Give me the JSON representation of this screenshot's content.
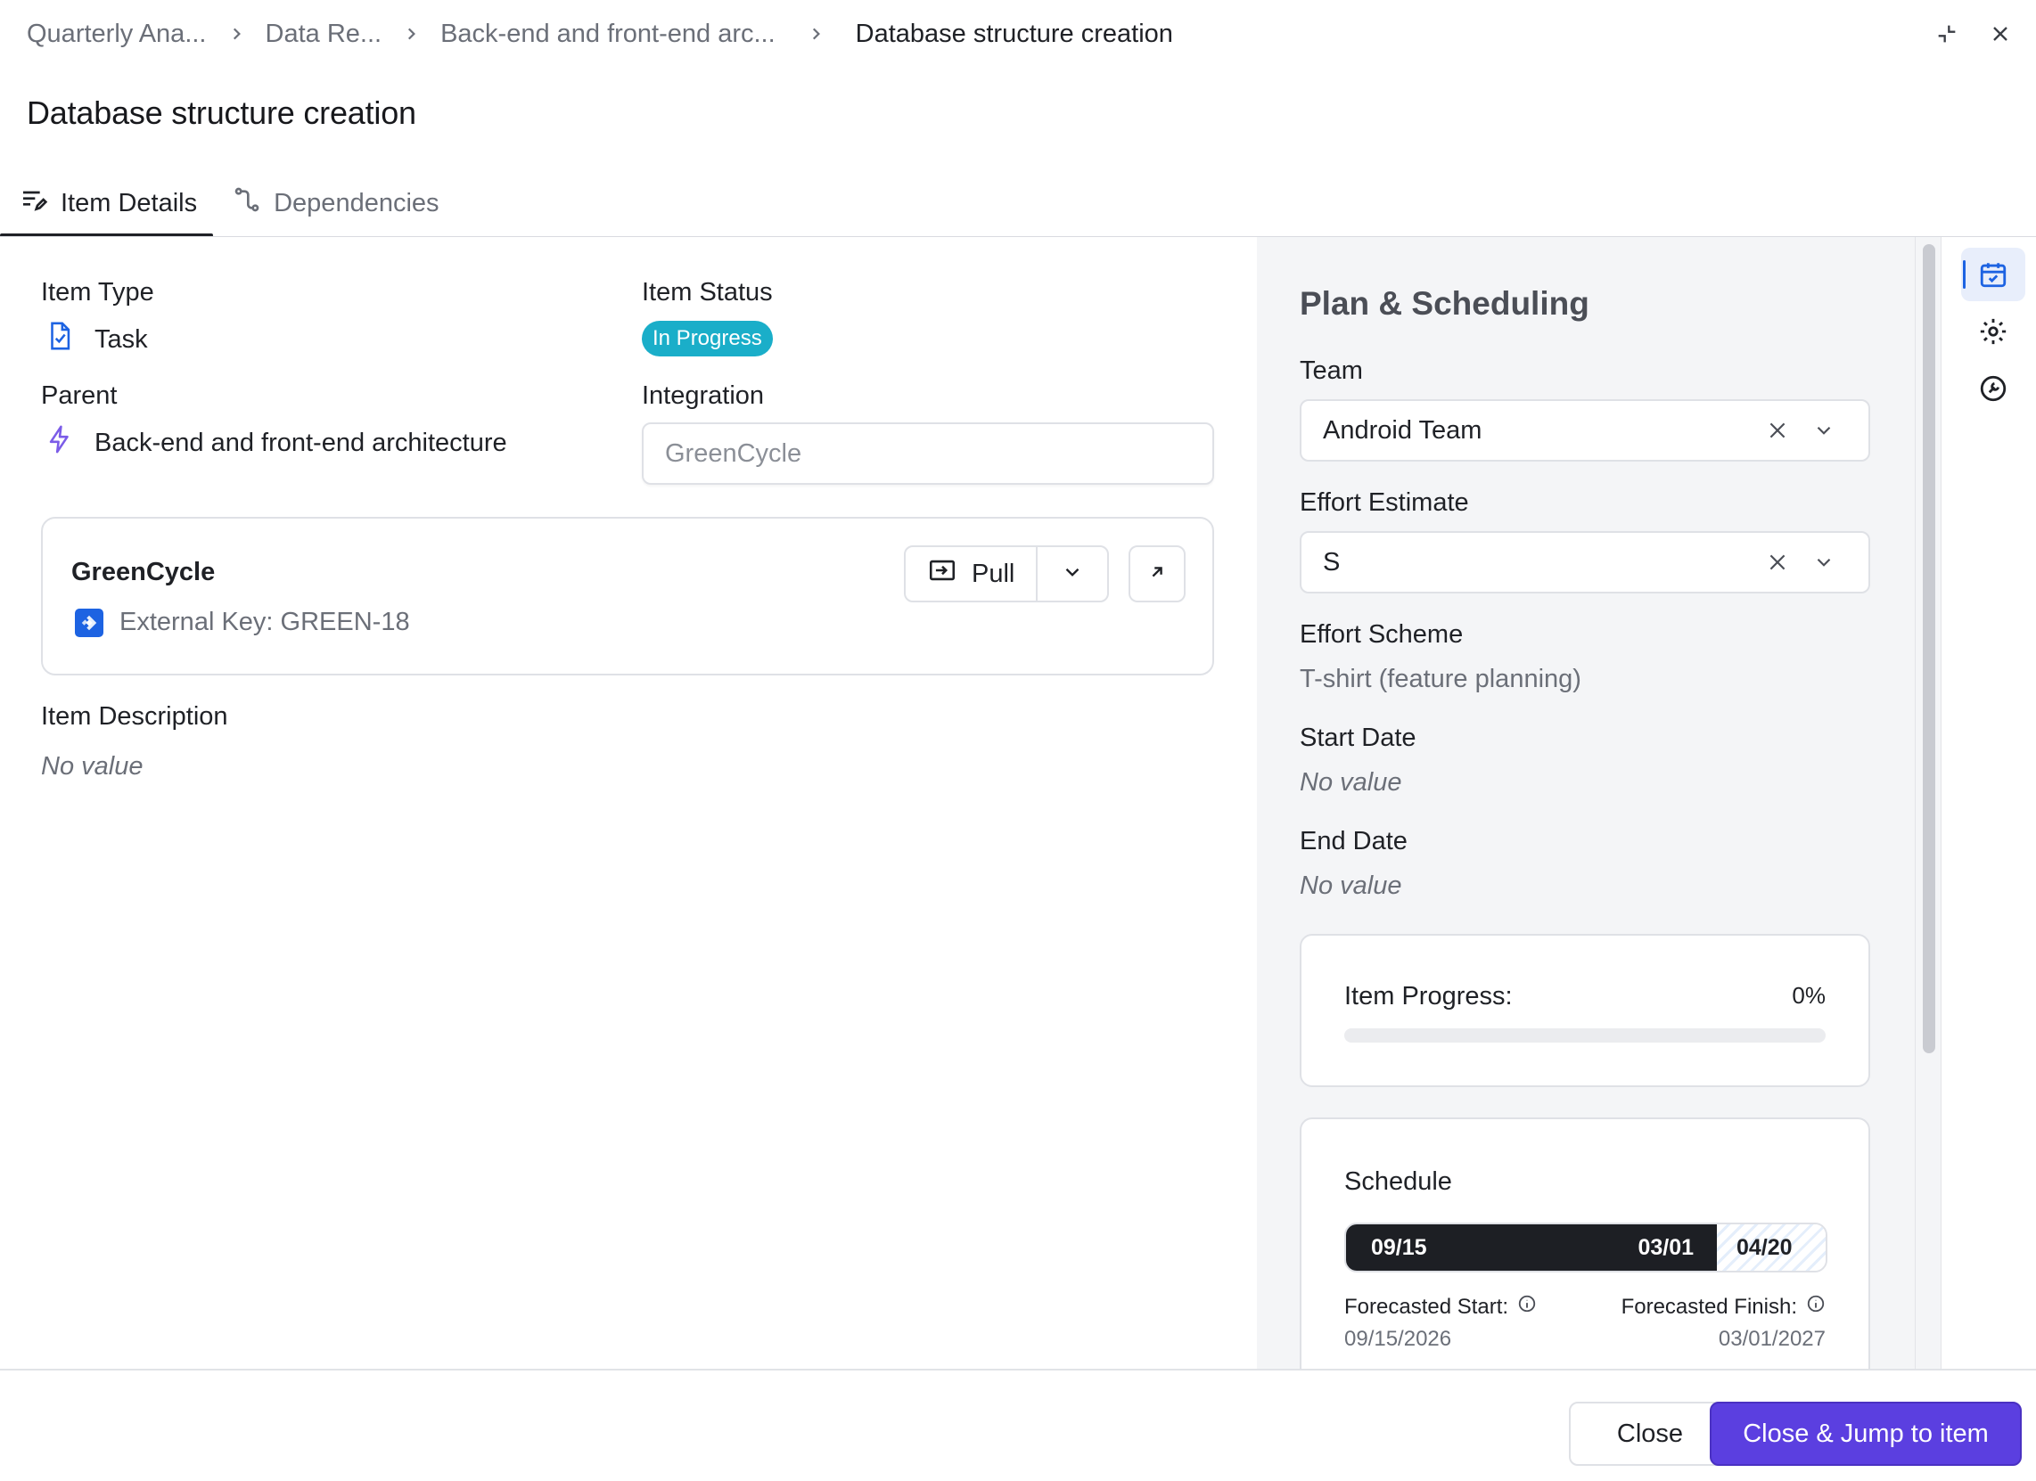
{
  "breadcrumb": {
    "items": [
      "Quarterly Ana...",
      "Data Re...",
      "Back-end and front-end arc...",
      "Database structure creation"
    ]
  },
  "window": {
    "minimize_icon": "collapse-icon",
    "close_icon": "close-icon"
  },
  "page_title": "Database structure creation",
  "tabs": [
    {
      "label": "Item Details",
      "icon": "edit-lines-icon",
      "active": true
    },
    {
      "label": "Dependencies",
      "icon": "dependency-icon",
      "active": false
    }
  ],
  "details": {
    "item_type": {
      "label": "Item Type",
      "value": "Task",
      "icon": "task-doc-icon"
    },
    "item_status": {
      "label": "Item Status",
      "value": "In Progress",
      "color": "#1aaec9"
    },
    "parent": {
      "label": "Parent",
      "value": "Back-end and front-end architecture",
      "icon": "lightning-icon"
    },
    "integration": {
      "label": "Integration",
      "placeholder": "GreenCycle"
    },
    "integration_card": {
      "title": "GreenCycle",
      "external_key": "External Key: GREEN-18",
      "pull_label": "Pull"
    },
    "description": {
      "label": "Item Description",
      "value": "No value"
    }
  },
  "plan": {
    "title": "Plan & Scheduling",
    "team": {
      "label": "Team",
      "value": "Android Team"
    },
    "effort_estimate": {
      "label": "Effort Estimate",
      "value": "S"
    },
    "effort_scheme": {
      "label": "Effort Scheme",
      "value": "T-shirt (feature planning)"
    },
    "start_date": {
      "label": "Start Date",
      "value": "No value"
    },
    "end_date": {
      "label": "End Date",
      "value": "No value"
    },
    "progress": {
      "label": "Item Progress:",
      "value": "0%",
      "fraction": 0
    },
    "schedule": {
      "title": "Schedule",
      "timeline_start": "09/15",
      "timeline_end": "03/01",
      "timeline_latest": "04/20",
      "forecasted_start_label": "Forecasted Start:",
      "forecasted_start": "09/15/2026",
      "forecasted_finish_label": "Forecasted Finish:",
      "forecasted_finish": "03/01/2027"
    }
  },
  "rail": [
    "calendar-check-icon",
    "gear-icon",
    "wrench-icon"
  ],
  "footer": {
    "close_label": "Close",
    "primary_label": "Close & Jump to item"
  },
  "colors": {
    "accent": "#5b3fe0",
    "status": "#1aaec9",
    "link_blue": "#1d63e2"
  }
}
